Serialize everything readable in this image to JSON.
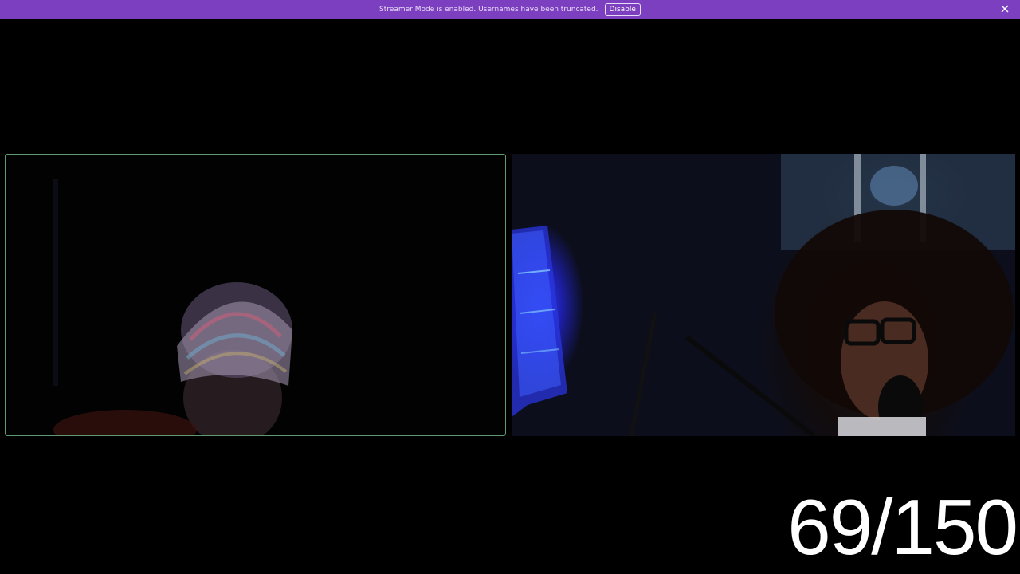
{
  "banner": {
    "message": "Streamer Mode is enabled. Usernames have been truncated.",
    "disable_label": "Disable",
    "close_icon": "close-icon",
    "background_color": "#7c3fbf"
  },
  "video_tiles": [
    {
      "speaking_border_color": "#5f9a73",
      "active_speaker": true
    },
    {
      "active_speaker": false
    }
  ],
  "counter": {
    "text": "69/150"
  }
}
